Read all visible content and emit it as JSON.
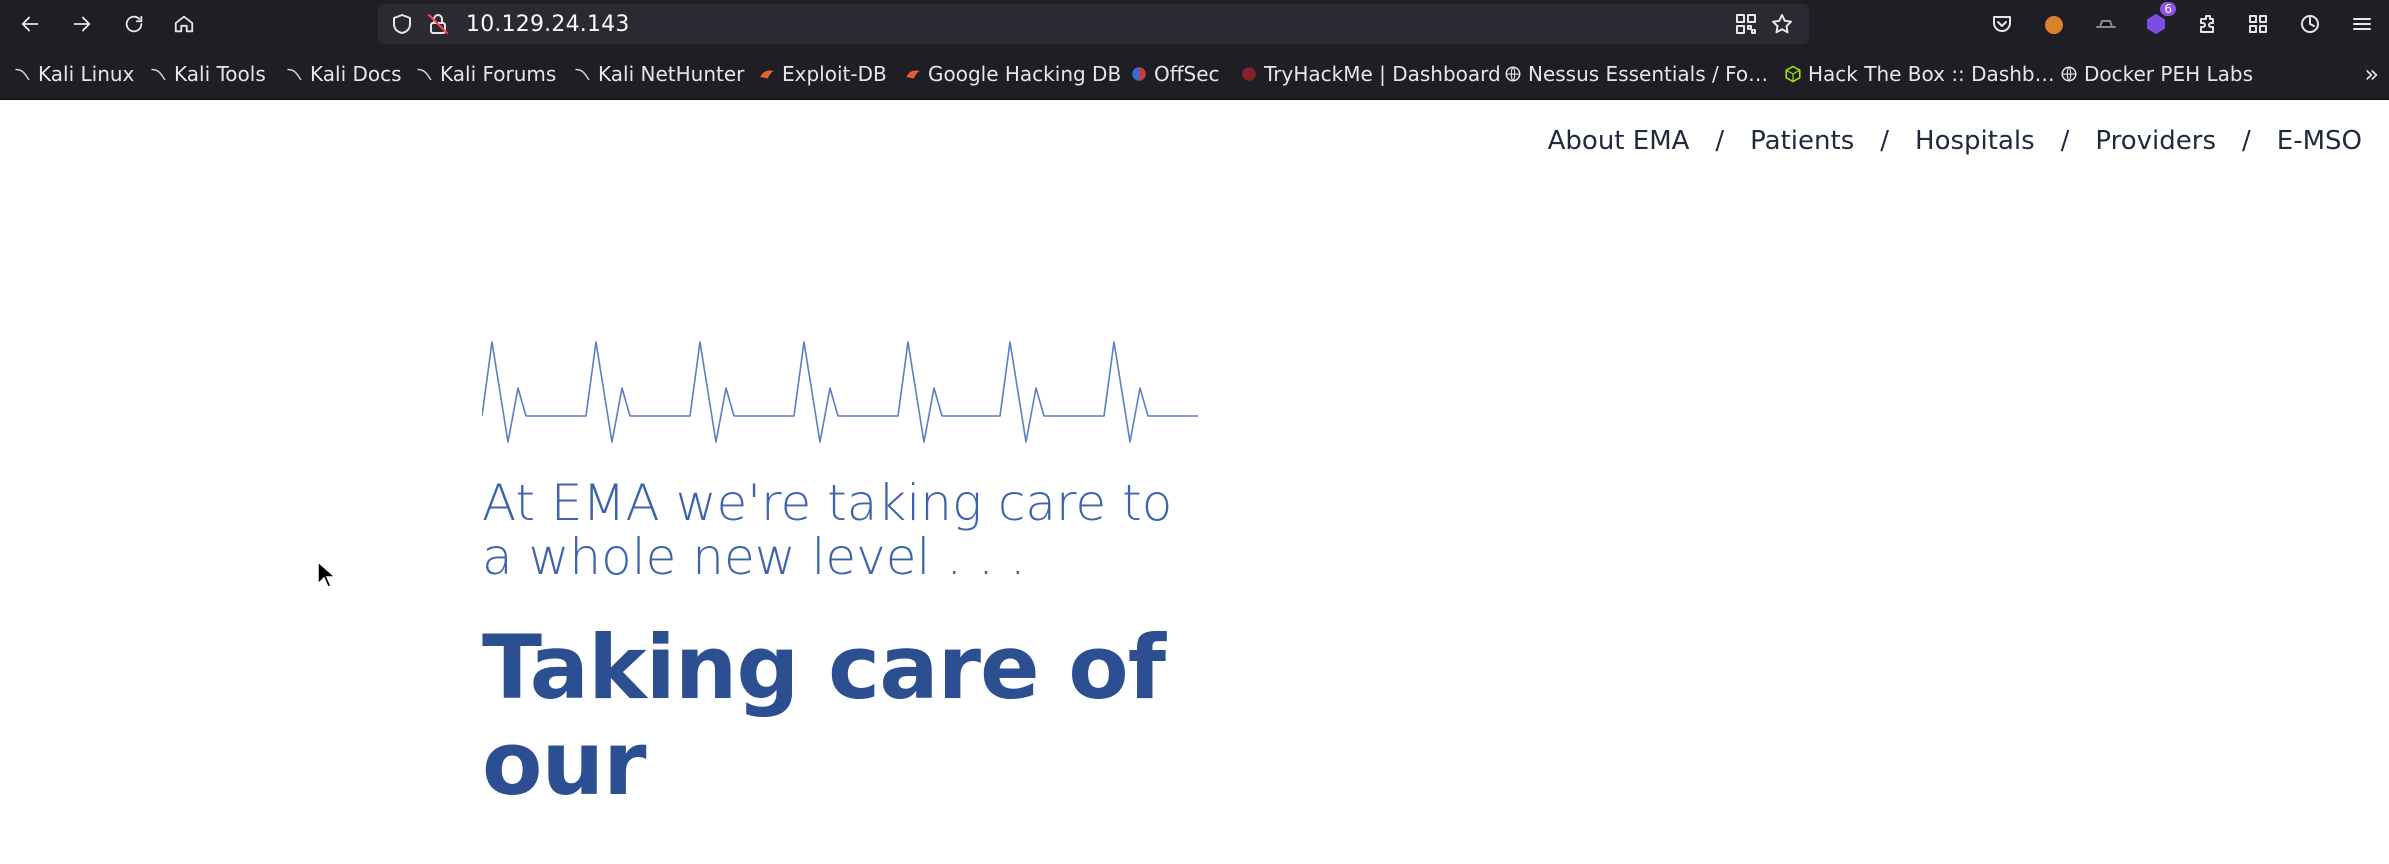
{
  "browser": {
    "url": "10.129.24.143",
    "extension_badge_count": "6"
  },
  "bookmarks": [
    {
      "label": "Kali Linux",
      "icon": "kali-dragon-icon"
    },
    {
      "label": "Kali Tools",
      "icon": "kali-dragon-icon"
    },
    {
      "label": "Kali Docs",
      "icon": "kali-dragon-icon"
    },
    {
      "label": "Kali Forums",
      "icon": "kali-dragon-icon"
    },
    {
      "label": "Kali NetHunter",
      "icon": "kali-dragon-icon"
    },
    {
      "label": "Exploit-DB",
      "icon": "exploit-db-icon"
    },
    {
      "label": "Google Hacking DB",
      "icon": "exploit-db-icon"
    },
    {
      "label": "OffSec",
      "icon": "offsec-icon"
    },
    {
      "label": "TryHackMe | Dashboard",
      "icon": "tryhackme-icon"
    },
    {
      "label": "Nessus Essentials / Fo…",
      "icon": "globe-icon"
    },
    {
      "label": "Hack The Box :: Dashb…",
      "icon": "htb-cube-icon"
    },
    {
      "label": "Docker PEH Labs",
      "icon": "globe-icon"
    }
  ],
  "nav": {
    "items": [
      "About EMA",
      "Patients",
      "Hospitals",
      "Providers",
      "E-MSO"
    ],
    "separator": "/"
  },
  "hero": {
    "tagline": "At EMA we're taking care to a whole new level . . .",
    "headline": "Taking care of our"
  },
  "colors": {
    "toolbar_bg": "#1f1e25",
    "urlbar_bg": "#2b2a33",
    "accent_light": "#3c63ab",
    "accent_dark": "#2c4f91",
    "ekg_line": "#5b7fc0"
  }
}
